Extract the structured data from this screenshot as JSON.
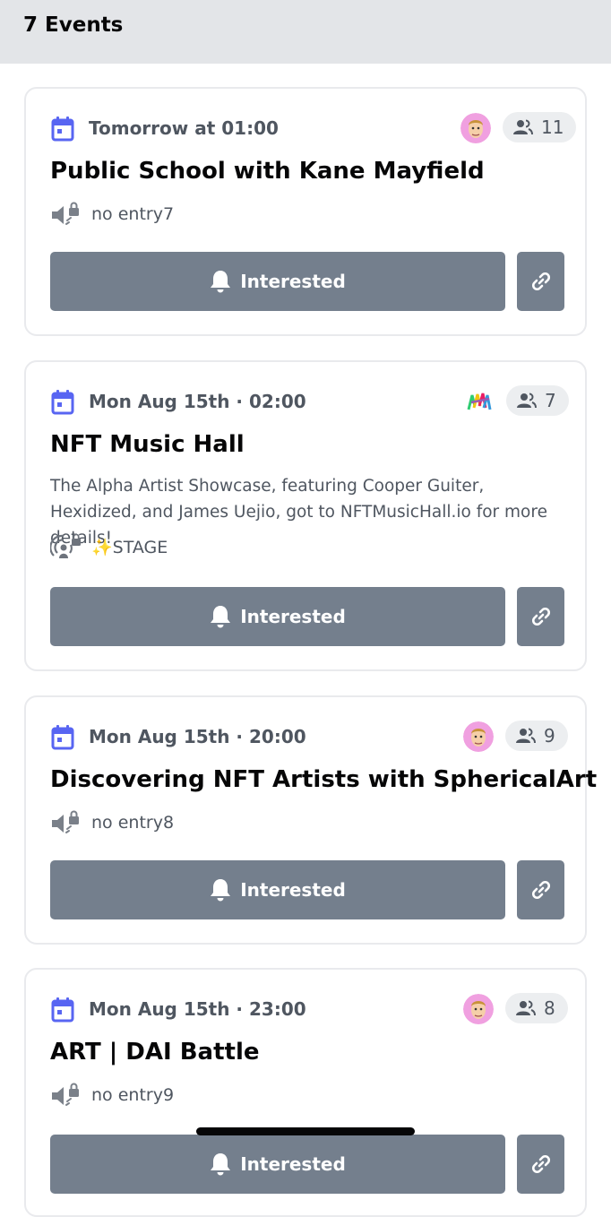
{
  "header": {
    "title": "7 Events"
  },
  "colors": {
    "accent": "#5865f2",
    "button": "#747f8d",
    "header_bg": "#e3e5e8"
  },
  "events": [
    {
      "date": "Tomorrow at 01:00",
      "title": "Public School with Kane Mayfield",
      "count": "11",
      "host_icon": "avatar-face",
      "location_icon": "speaker-lock-icon",
      "location": "no entry7",
      "interested_label": "Interested"
    },
    {
      "date": "Mon Aug 15th · 02:00",
      "title": "NFT Music Hall",
      "count": "7",
      "host_icon": "colorful-logo",
      "description": "The Alpha Artist Showcase, featuring Cooper Guiter, Hexidized, and James Uejio, got to NFTMusicHall.io for more details!",
      "location_icon": "stage-lock-icon",
      "location": "✨STAGE",
      "interested_label": "Interested"
    },
    {
      "date": "Mon Aug 15th · 20:00",
      "title": "Discovering NFT Artists with SphericalArt",
      "count": "9",
      "host_icon": "avatar-face",
      "location_icon": "speaker-lock-icon",
      "location": "no entry8",
      "interested_label": "Interested"
    },
    {
      "date": "Mon Aug 15th · 23:00",
      "title": "ART | DAI Battle",
      "count": "8",
      "host_icon": "avatar-face",
      "location_icon": "speaker-lock-icon",
      "location": "no entry9",
      "interested_label": "Interested"
    }
  ]
}
